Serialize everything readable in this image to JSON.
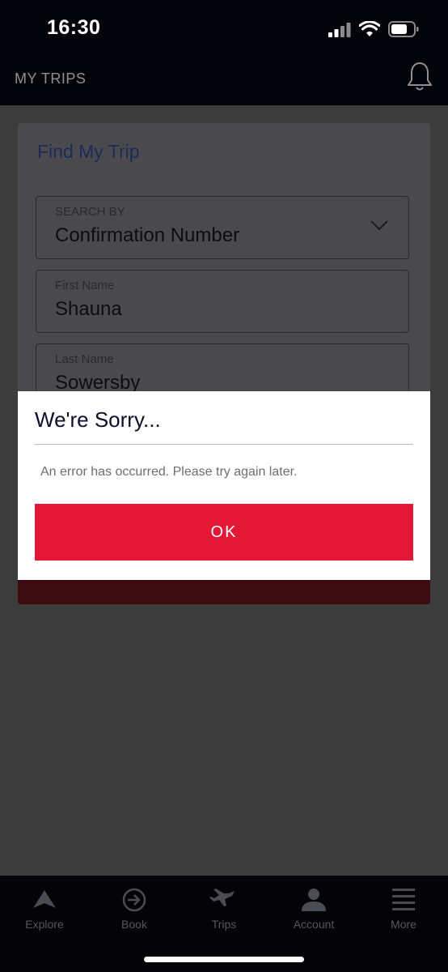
{
  "status_bar": {
    "time": "16:30"
  },
  "header": {
    "title": "MY TRIPS"
  },
  "card": {
    "title": "Find My Trip",
    "search_by": {
      "label": "SEARCH BY",
      "value": "Confirmation Number"
    },
    "first_name": {
      "label": "First Name",
      "value": "Shauna"
    },
    "last_name": {
      "label": "Last Name",
      "value": "Sowersby"
    }
  },
  "dialog": {
    "title": "We're Sorry...",
    "message": "An error has occurred. Please try again later.",
    "ok_label": "OK"
  },
  "tab_bar": {
    "items": [
      {
        "label": "Explore",
        "icon": "delta-widget-icon"
      },
      {
        "label": "Book",
        "icon": "arrow-circle-icon"
      },
      {
        "label": "Trips",
        "icon": "airplane-icon"
      },
      {
        "label": "Account",
        "icon": "person-icon"
      },
      {
        "label": "More",
        "icon": "menu-icon"
      }
    ]
  },
  "colors": {
    "accent": "#e31837",
    "header_bg": "#04050b",
    "card_title": "#1c2a5e"
  }
}
